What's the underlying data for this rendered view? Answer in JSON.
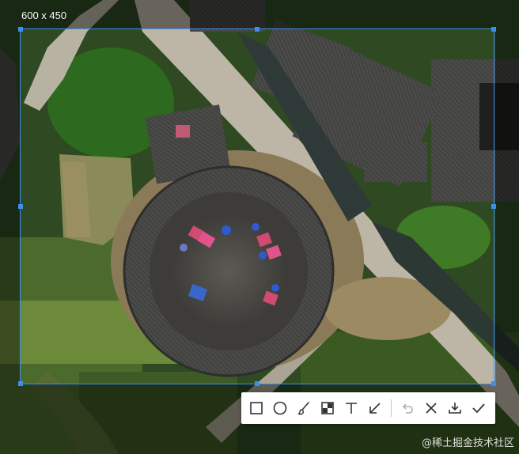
{
  "selection": {
    "size_label": "600 x 450",
    "accent_color": "#3b8ff0"
  },
  "toolbar": {
    "tools": [
      {
        "name": "rectangle-icon",
        "title": "Rectangle"
      },
      {
        "name": "ellipse-icon",
        "title": "Ellipse"
      },
      {
        "name": "brush-icon",
        "title": "Brush"
      },
      {
        "name": "mosaic-icon",
        "title": "Mosaic"
      },
      {
        "name": "text-icon",
        "title": "Text"
      },
      {
        "name": "arrow-icon",
        "title": "Arrow"
      },
      {
        "name": "undo-icon",
        "title": "Undo"
      },
      {
        "name": "close-icon",
        "title": "Cancel"
      },
      {
        "name": "download-icon",
        "title": "Save"
      },
      {
        "name": "check-icon",
        "title": "Confirm"
      }
    ],
    "disabled_color": "#b0b0b0",
    "icon_color": "#333333"
  },
  "watermark": {
    "text": "@稀土掘金技术社区"
  }
}
